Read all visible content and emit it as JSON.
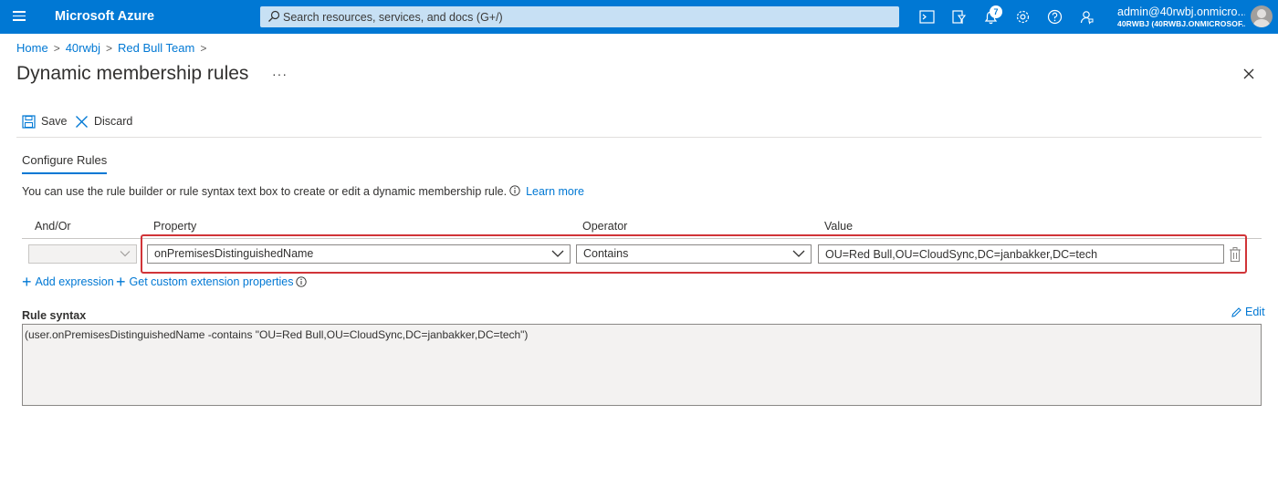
{
  "topbar": {
    "brand": "Microsoft Azure",
    "search_placeholder": "Search resources, services, and docs (G+/)",
    "notifications_count": "7",
    "account_name": "admin@40rwbj.onmicro...",
    "account_tenant": "40RWBJ (40RWBJ.ONMICROSOF..."
  },
  "breadcrumb": {
    "items": [
      "Home",
      "40rwbj",
      "Red Bull Team"
    ],
    "separator": ">"
  },
  "page": {
    "title": "Dynamic membership rules",
    "more": "···"
  },
  "commands": {
    "save": "Save",
    "discard": "Discard"
  },
  "tabs": {
    "configure_rules": "Configure Rules"
  },
  "description": {
    "text": "You can use the rule builder or rule syntax text box to create or edit a dynamic membership rule.",
    "learn_more": "Learn more"
  },
  "grid": {
    "headers": {
      "and_or": "And/Or",
      "property": "Property",
      "operator": "Operator",
      "value": "Value"
    },
    "row": {
      "and_or": "",
      "property": "onPremisesDistinguishedName",
      "operator": "Contains",
      "value": "OU=Red Bull,OU=CloudSync,DC=janbakker,DC=tech"
    }
  },
  "actions": {
    "add_expression": "Add expression",
    "custom_extension": "Get custom extension properties"
  },
  "rule_syntax": {
    "label": "Rule syntax",
    "edit": "Edit",
    "text": "(user.onPremisesDistinguishedName -contains \"OU=Red Bull,OU=CloudSync,DC=janbakker,DC=tech\")"
  },
  "colors": {
    "accent": "#0078d4",
    "highlight": "#d13438"
  }
}
